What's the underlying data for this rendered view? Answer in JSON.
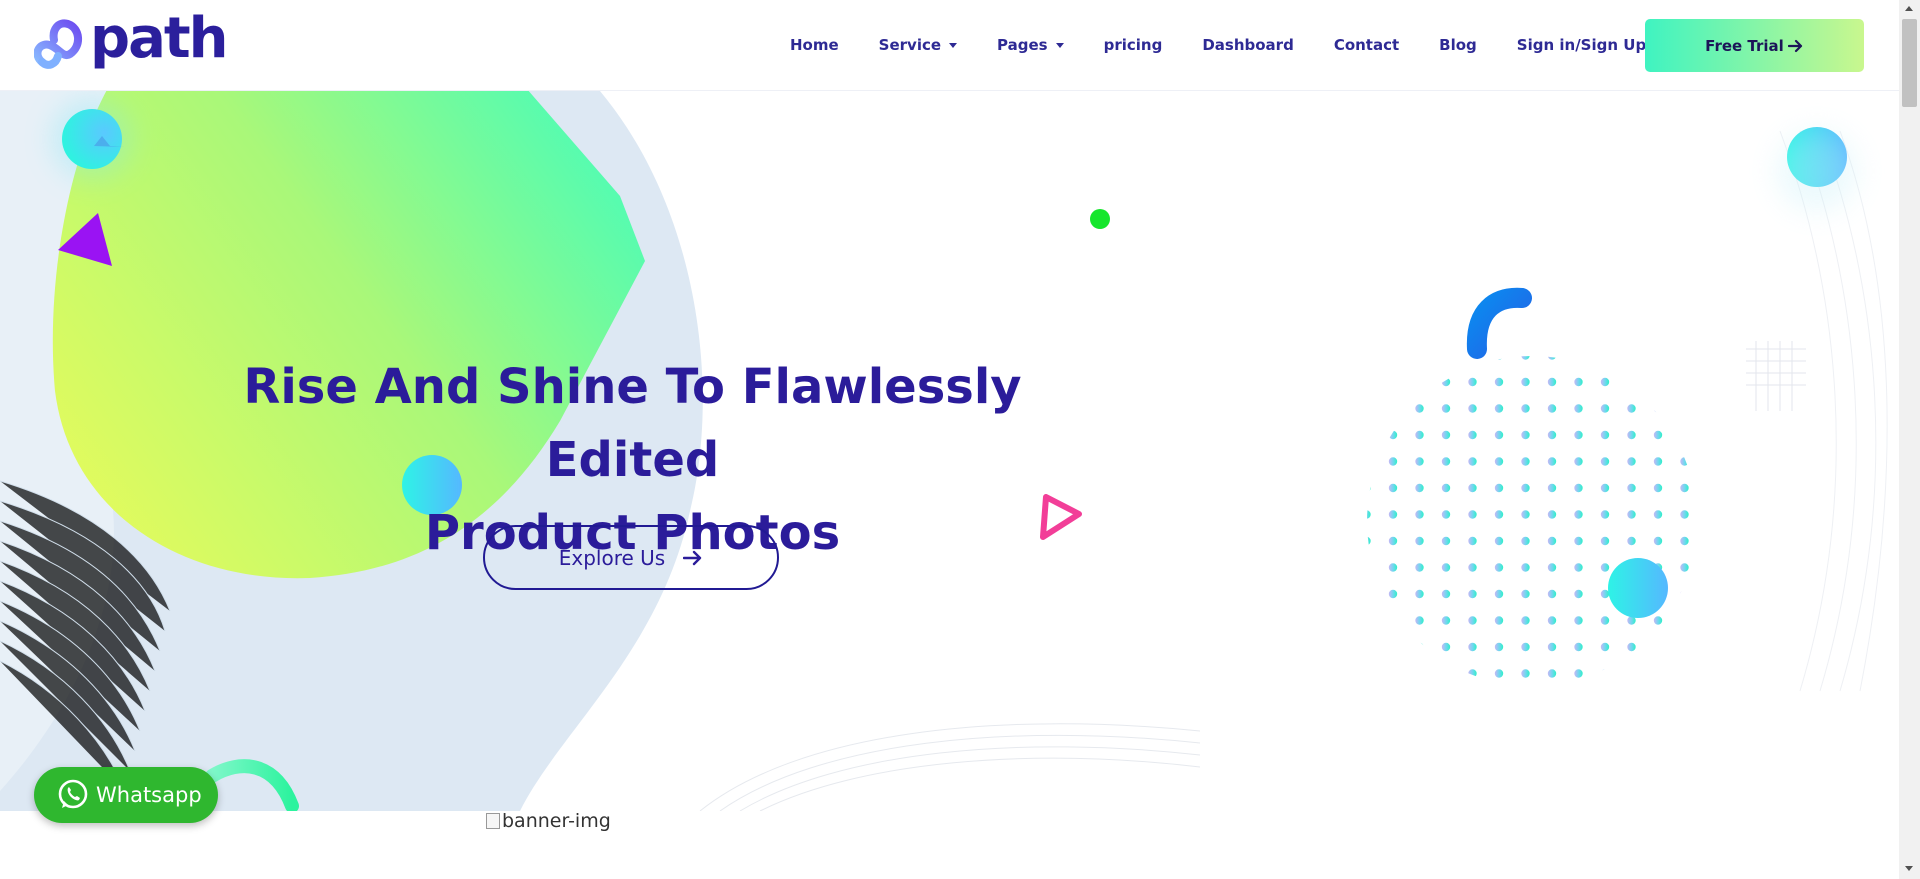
{
  "brand": {
    "name": "path"
  },
  "nav": {
    "items": [
      {
        "label": "Home",
        "dropdown": false
      },
      {
        "label": "Service",
        "dropdown": true
      },
      {
        "label": "Pages",
        "dropdown": true
      },
      {
        "label": "pricing",
        "dropdown": false
      },
      {
        "label": "Dashboard",
        "dropdown": false
      },
      {
        "label": "Contact",
        "dropdown": false
      },
      {
        "label": "Blog",
        "dropdown": false
      },
      {
        "label": "Sign in/Sign Up",
        "dropdown": false
      }
    ],
    "cta": {
      "label": "Free Trial",
      "icon": "arrow-right-icon"
    }
  },
  "hero": {
    "title_line1": "Rise And Shine To Flawlessly Edited",
    "title_line2": "Product Photos",
    "button": {
      "label": "Explore Us",
      "icon": "arrow-right-icon"
    },
    "image_alt": "banner-img"
  },
  "whatsapp": {
    "label": "Whatsapp",
    "icon": "whatsapp-icon"
  },
  "colors": {
    "primary": "#2b1c9a",
    "accent_green": "#3ff3c1",
    "accent_lime": "#d7f86a",
    "whatsapp": "#2fb72f",
    "pink": "#f0479a",
    "purple": "#9b15f0"
  }
}
